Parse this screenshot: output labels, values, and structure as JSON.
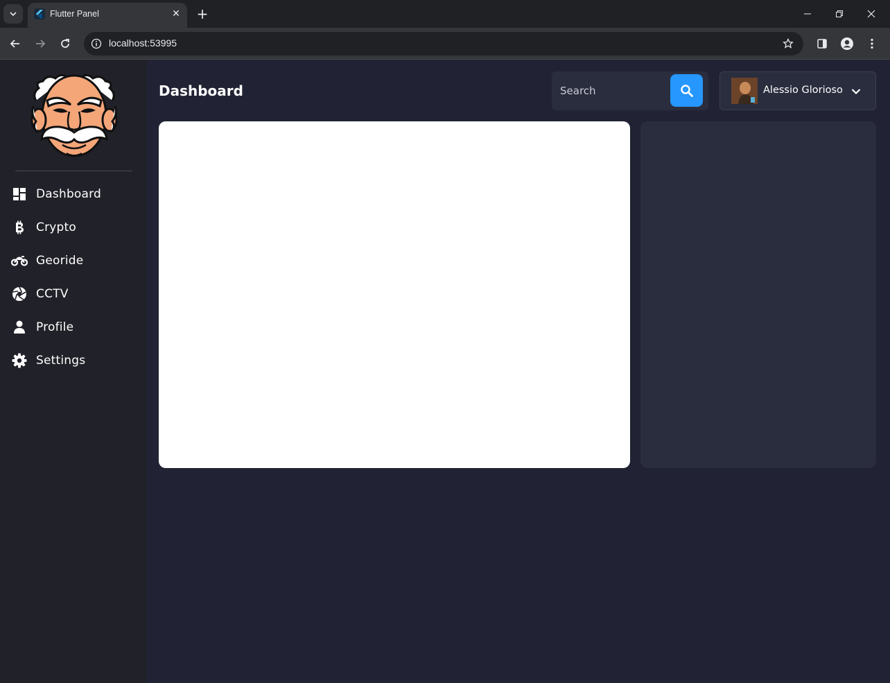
{
  "browser": {
    "tab_title": "Flutter Panel",
    "url": "localhost:53995"
  },
  "sidebar": {
    "items": [
      {
        "label": "Dashboard",
        "icon": "dashboard-icon"
      },
      {
        "label": "Crypto",
        "icon": "bitcoin-icon"
      },
      {
        "label": "Georide",
        "icon": "motorcycle-icon"
      },
      {
        "label": "CCTV",
        "icon": "camera-shutter-icon"
      },
      {
        "label": "Profile",
        "icon": "person-icon"
      },
      {
        "label": "Settings",
        "icon": "gear-icon"
      }
    ]
  },
  "header": {
    "title": "Dashboard",
    "search_placeholder": "Search",
    "user_name": "Alessio Glorioso"
  },
  "colors": {
    "accent": "#2697ff",
    "sidebar_bg": "#212129",
    "main_bg": "#212334",
    "card_dark": "#2a2d3e"
  }
}
